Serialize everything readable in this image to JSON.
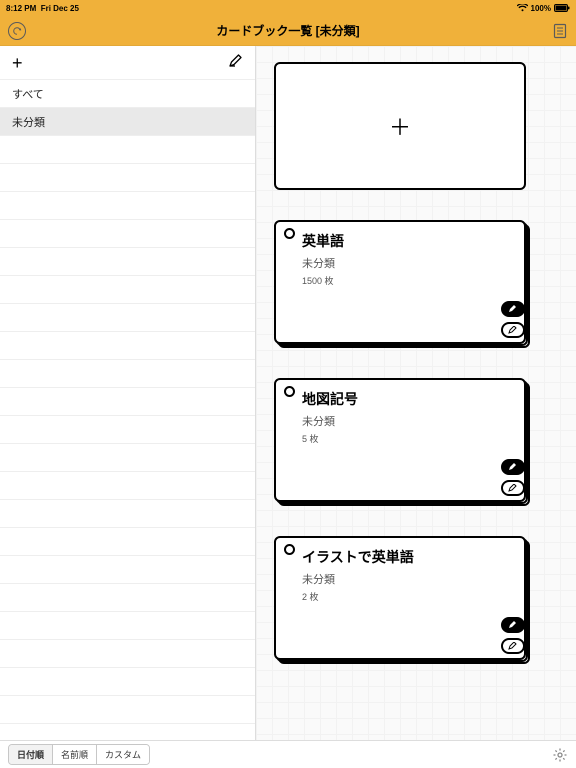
{
  "status": {
    "time": "8:12 PM",
    "date": "Fri Dec 25",
    "battery": "100%"
  },
  "header": {
    "title": "カードブック一覧 [未分類]"
  },
  "sidebar": {
    "items": [
      {
        "label": "すべて",
        "selected": false
      },
      {
        "label": "未分類",
        "selected": true
      }
    ],
    "empty_rows": 22
  },
  "decks": [
    {
      "title": "英単語",
      "category": "未分類",
      "count": "1500 枚"
    },
    {
      "title": "地図記号",
      "category": "未分類",
      "count": "5 枚"
    },
    {
      "title": "イラストで英単語",
      "category": "未分類",
      "count": "2 枚"
    }
  ],
  "footer": {
    "segments": [
      {
        "label": "日付順",
        "active": true
      },
      {
        "label": "名前順",
        "active": false
      },
      {
        "label": "カスタム",
        "active": false
      }
    ]
  },
  "icons": {
    "plus": "+",
    "add_card_plus": "＋"
  }
}
